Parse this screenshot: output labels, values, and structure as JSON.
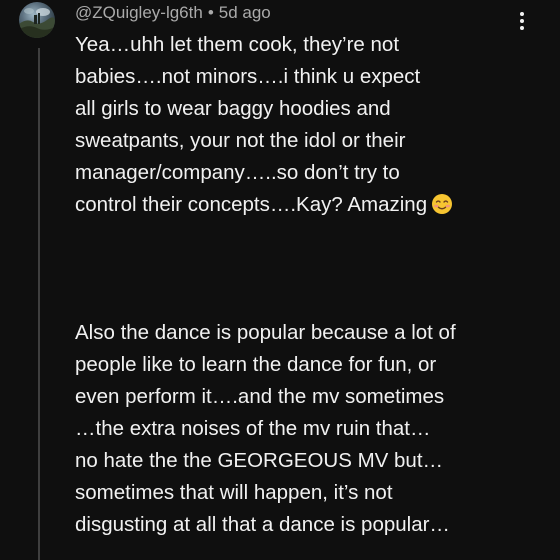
{
  "comment": {
    "author": "@ZQuigley-lg6th",
    "separator": "•",
    "timestamp": "5d ago",
    "paragraph1": [
      "Yea…uhh let them cook, they’re not",
      "babies….not minors….i think u expect",
      "all girls to wear baggy hoodies and",
      "sweatpants, your not the idol or their",
      "manager/company…..so don’t try to",
      "control their concepts….Kay? Amazing"
    ],
    "paragraph2": [
      "Also the dance is popular because a lot of",
      "people like to learn the dance for fun, or",
      "even perform it….and the mv sometimes",
      "…the extra noises of the mv ruin that…",
      "no hate the the GEORGEOUS MV but…",
      "sometimes that will happen, it’s not",
      "disgusting at all that a dance is popular…"
    ],
    "emoji_icon": "smiling-face-emoji-icon",
    "menu_icon": "more-vertical-icon"
  }
}
